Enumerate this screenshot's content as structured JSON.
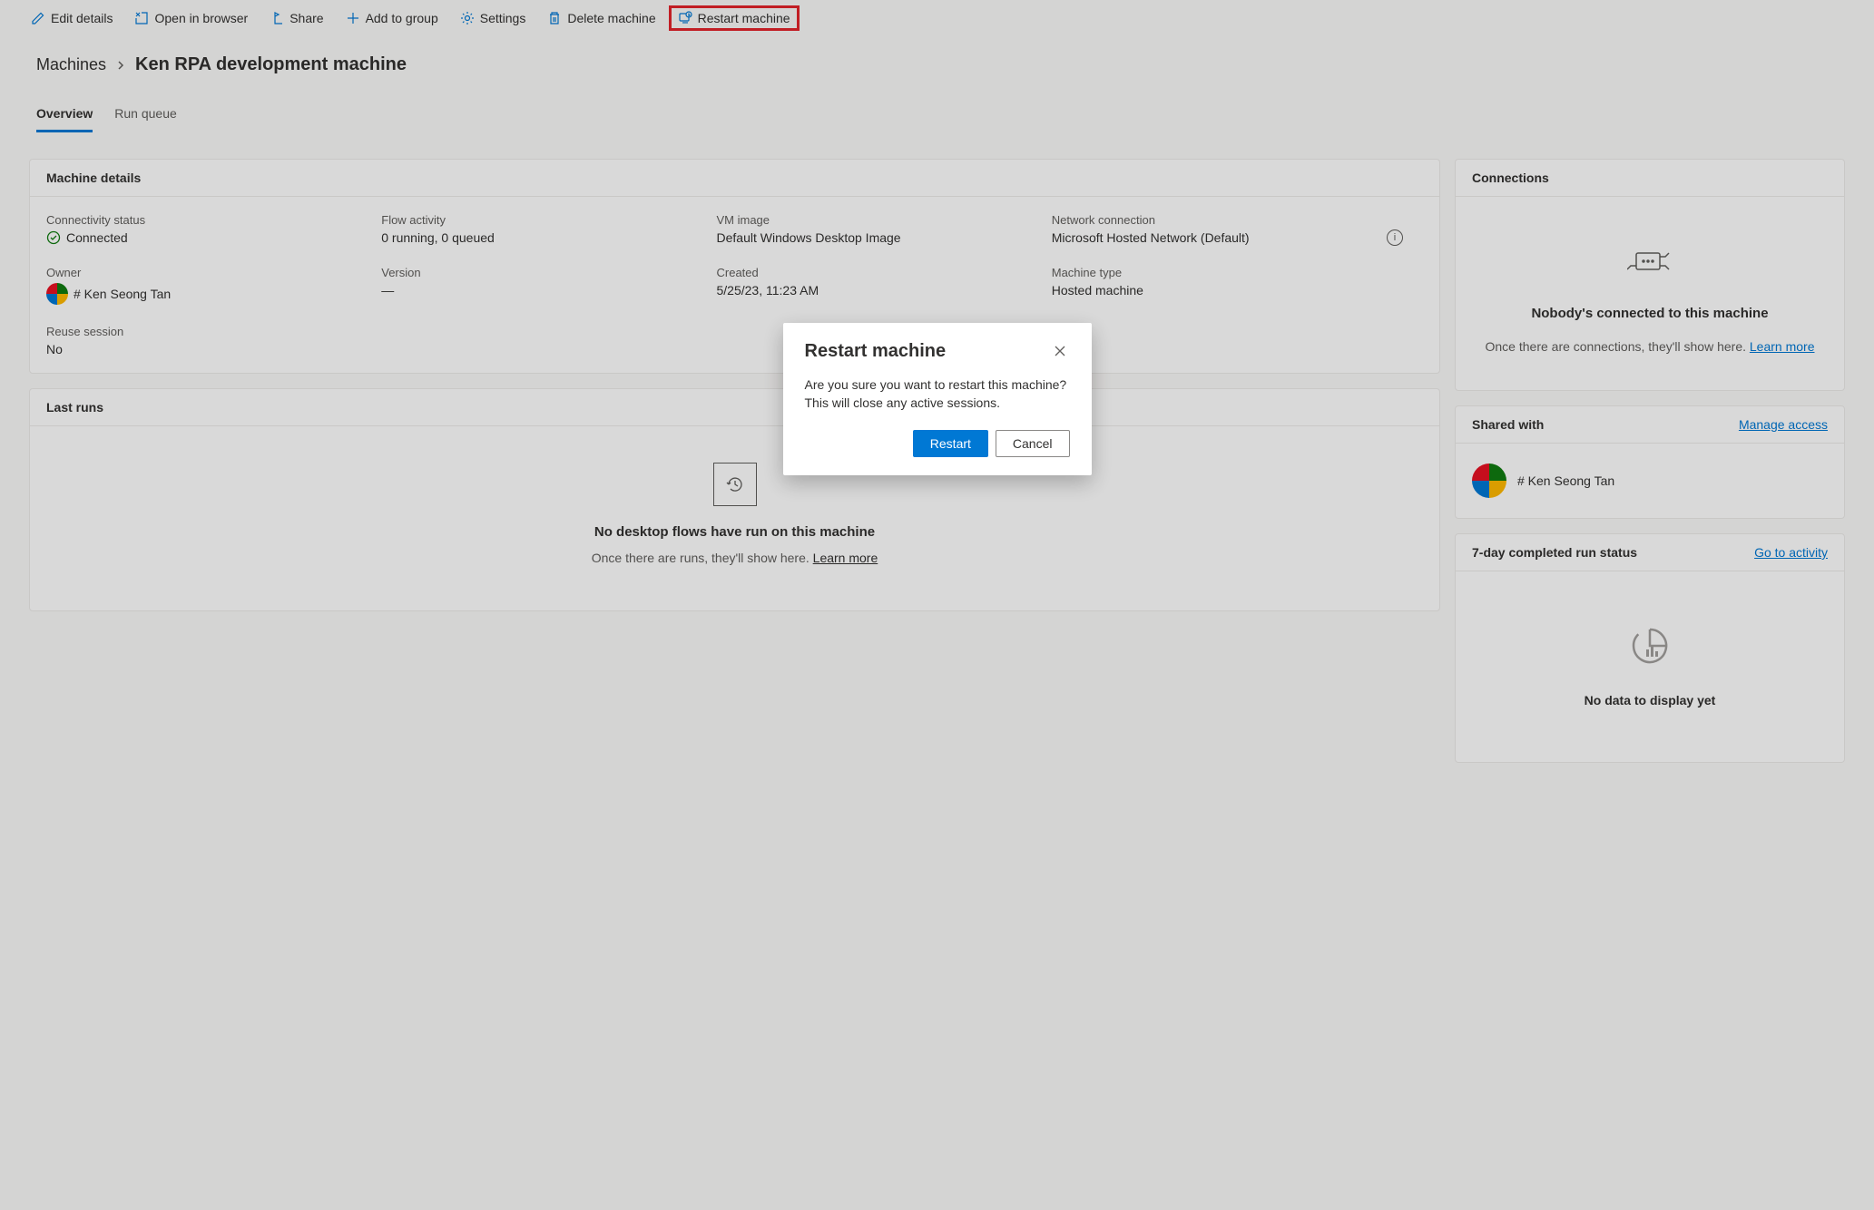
{
  "toolbar": {
    "edit": "Edit details",
    "open": "Open in browser",
    "share": "Share",
    "add_group": "Add to group",
    "settings": "Settings",
    "delete": "Delete machine",
    "restart": "Restart machine"
  },
  "breadcrumb": {
    "root": "Machines",
    "current": "Ken RPA development machine"
  },
  "tabs": {
    "overview": "Overview",
    "run_queue": "Run queue"
  },
  "machine_details": {
    "title": "Machine details",
    "connectivity_label": "Connectivity status",
    "connectivity_value": "Connected",
    "flow_label": "Flow activity",
    "flow_value": "0 running, 0 queued",
    "vm_label": "VM image",
    "vm_value": "Default Windows Desktop Image",
    "network_label": "Network connection",
    "network_value": "Microsoft Hosted Network (Default)",
    "owner_label": "Owner",
    "owner_value": "# Ken Seong Tan",
    "version_label": "Version",
    "version_value": "—",
    "created_label": "Created",
    "created_value": "5/25/23, 11:23 AM",
    "machine_type_label": "Machine type",
    "machine_type_value": "Hosted machine",
    "reuse_label": "Reuse session",
    "reuse_value": "No"
  },
  "last_runs": {
    "title": "Last runs",
    "empty_title": "No desktop flows have run on this machine",
    "empty_sub_pre": "Once there are runs, they'll show here. ",
    "learn_more": "Learn more"
  },
  "connections": {
    "title": "Connections",
    "empty_title": "Nobody's connected to this machine",
    "empty_sub_pre": "Once there are connections, they'll show here. ",
    "learn_more": "Learn more"
  },
  "shared_with": {
    "title": "Shared with",
    "manage": "Manage access",
    "user": "# Ken Seong Tan"
  },
  "run_status": {
    "title": "7-day completed run status",
    "link": "Go to activity",
    "empty": "No data to display yet"
  },
  "dialog": {
    "title": "Restart machine",
    "body": "Are you sure you want to restart this machine? This will close any active sessions.",
    "restart": "Restart",
    "cancel": "Cancel"
  }
}
